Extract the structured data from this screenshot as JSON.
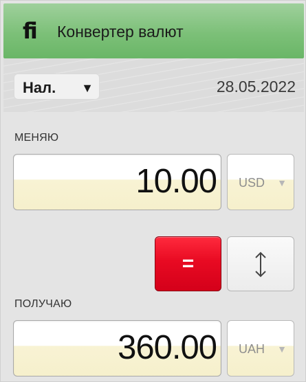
{
  "header": {
    "logo_text": "fi",
    "title": "Конвертер валют"
  },
  "toolbar": {
    "rate_type": "Нал.",
    "date": "28.05.2022"
  },
  "give": {
    "label": "МЕНЯЮ",
    "amount": "10.00",
    "currency": "USD"
  },
  "get": {
    "label": "ПОЛУЧАЮ",
    "amount": "360.00",
    "currency": "UAH"
  },
  "buttons": {
    "convert_label": "="
  },
  "icons": {
    "dropdown": "triangle-down",
    "swap": "vertical-double-arrow"
  },
  "colors": {
    "header_green": "#7cc078",
    "convert_red": "#e80a22",
    "field_yellow": "#f6f0cc"
  }
}
